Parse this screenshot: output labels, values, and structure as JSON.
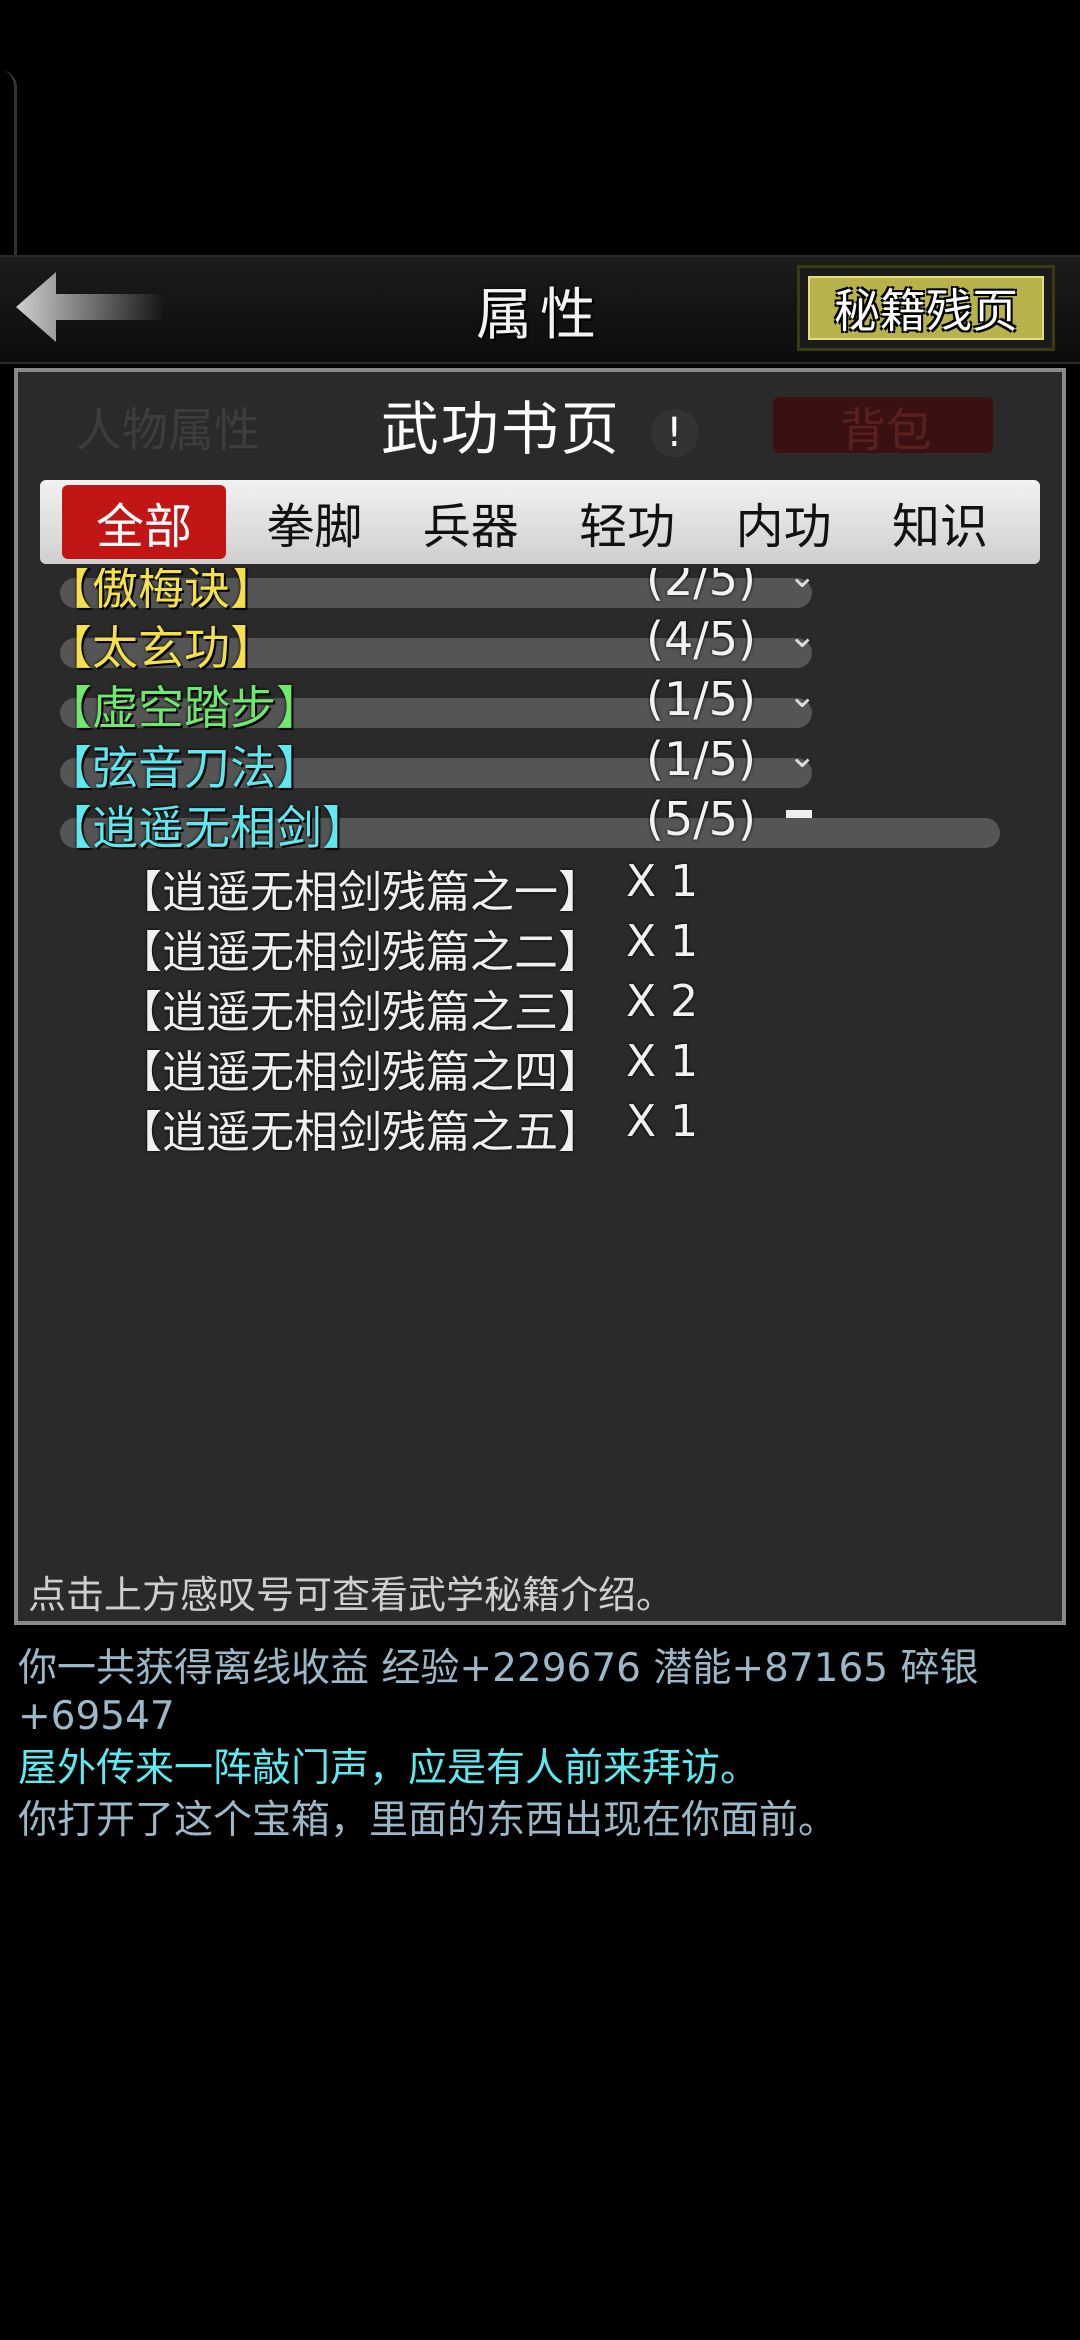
{
  "header": {
    "title": "属性",
    "scrap_button": "秘籍残页"
  },
  "background": {
    "label_character": "人物属性",
    "label_backpack": "背包"
  },
  "panel": {
    "title": "武功书页",
    "info_badge": "!",
    "footer_hint": "点击上方感叹号可查看武学秘籍介绍。"
  },
  "tabs": [
    "全部",
    "拳脚",
    "兵器",
    "轻功",
    "内功",
    "知识"
  ],
  "active_tab": "全部",
  "categories": [
    {
      "name": "【傲梅诀】",
      "progress": "(2/5)",
      "color": "#f5e04b",
      "expanded": false
    },
    {
      "name": "【太玄功】",
      "progress": "(4/5)",
      "color": "#f5e04b",
      "expanded": false
    },
    {
      "name": "【虚空踏步】",
      "progress": "(1/5)",
      "color": "#6ee86e",
      "expanded": false
    },
    {
      "name": "【弦音刀法】",
      "progress": "(1/5)",
      "color": "#5ee8f0",
      "expanded": false
    },
    {
      "name": "【逍遥无相剑】",
      "progress": "(5/5)",
      "color": "#5ee8f0",
      "expanded": true
    }
  ],
  "pieces": [
    {
      "name": "【逍遥无相剑残篇之一】",
      "count": "X 1"
    },
    {
      "name": "【逍遥无相剑残篇之二】",
      "count": "X 1"
    },
    {
      "name": "【逍遥无相剑残篇之三】",
      "count": "X 2"
    },
    {
      "name": "【逍遥无相剑残篇之四】",
      "count": "X 1"
    },
    {
      "name": "【逍遥无相剑残篇之五】",
      "count": "X 1"
    }
  ],
  "log": [
    {
      "text": "你一共获得离线收益 经验+229676 潜能+87165 碎银+69547",
      "color": "#9ab8c8"
    },
    {
      "text": "屋外传来一阵敲门声，应是有人前来拜访。",
      "color": "#5ee8f0"
    },
    {
      "text": "你打开了这个宝箱，里面的东西出现在你面前。",
      "color": "#9ab8c8"
    }
  ]
}
